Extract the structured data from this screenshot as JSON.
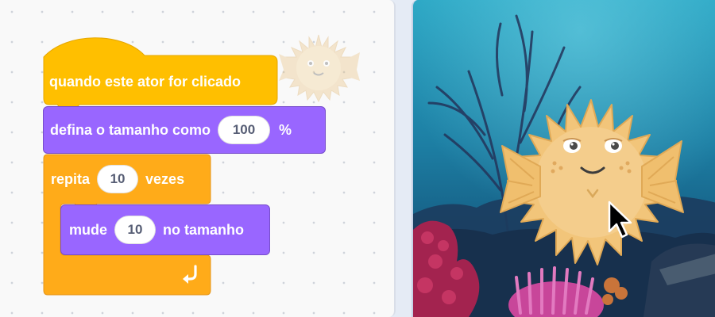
{
  "script": {
    "hat_label": "quando este ator for clicado",
    "set_size": {
      "prefix": "defina o tamanho como",
      "value": "100",
      "suffix": "%"
    },
    "repeat": {
      "prefix": "repita",
      "value": "10",
      "suffix": "vezes"
    },
    "change_size": {
      "prefix": "mude",
      "value": "10",
      "suffix": "no tamanho"
    },
    "loop_arrow_icon": "loop-arrow-icon"
  },
  "sprite_ghost": {
    "icon": "pufferfish-sprite-icon"
  },
  "stage": {
    "backdrop": "underwater-reef",
    "sprite": "pufferfish",
    "cursor": "mouse-pointer-icon"
  },
  "colors": {
    "events": "#ffbf00",
    "looks": "#9966ff",
    "control": "#ffab19",
    "pill_text": "#575e75"
  }
}
